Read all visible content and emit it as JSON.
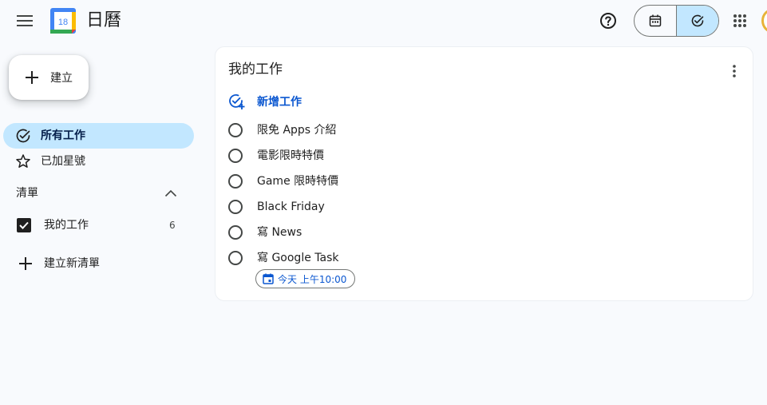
{
  "header": {
    "app_title": "日曆",
    "logo_day": "18",
    "menu_icon": "hamburger-menu-icon",
    "help_icon": "help-circle-icon",
    "toggle": [
      {
        "icon": "calendar-icon",
        "active": false
      },
      {
        "icon": "task-check-icon",
        "active": true
      }
    ],
    "apps_icon": "apps-grid-icon"
  },
  "sidebar": {
    "create_label": "建立",
    "nav": [
      {
        "label": "所有工作",
        "icon": "check-circle-icon",
        "active": true
      },
      {
        "label": "已加星號",
        "icon": "star-icon",
        "active": false
      }
    ],
    "lists_title": "清單",
    "lists": [
      {
        "label": "我的工作",
        "count": "6",
        "checked": true
      }
    ],
    "new_list_label": "建立新清單"
  },
  "main": {
    "list_title": "我的工作",
    "add_task_label": "新增工作",
    "tasks": [
      {
        "title": "限免 Apps 介紹"
      },
      {
        "title": "電影限時特價"
      },
      {
        "title": "Game 限時特價"
      },
      {
        "title": "Black Friday"
      },
      {
        "title": "寫 News"
      },
      {
        "title": "寫 Google Task"
      }
    ],
    "due_chip": "今天 上午10:00"
  },
  "colors": {
    "accent": "#0b57d0",
    "active_bg": "#c2e7ff",
    "background": "#f8fafd"
  }
}
